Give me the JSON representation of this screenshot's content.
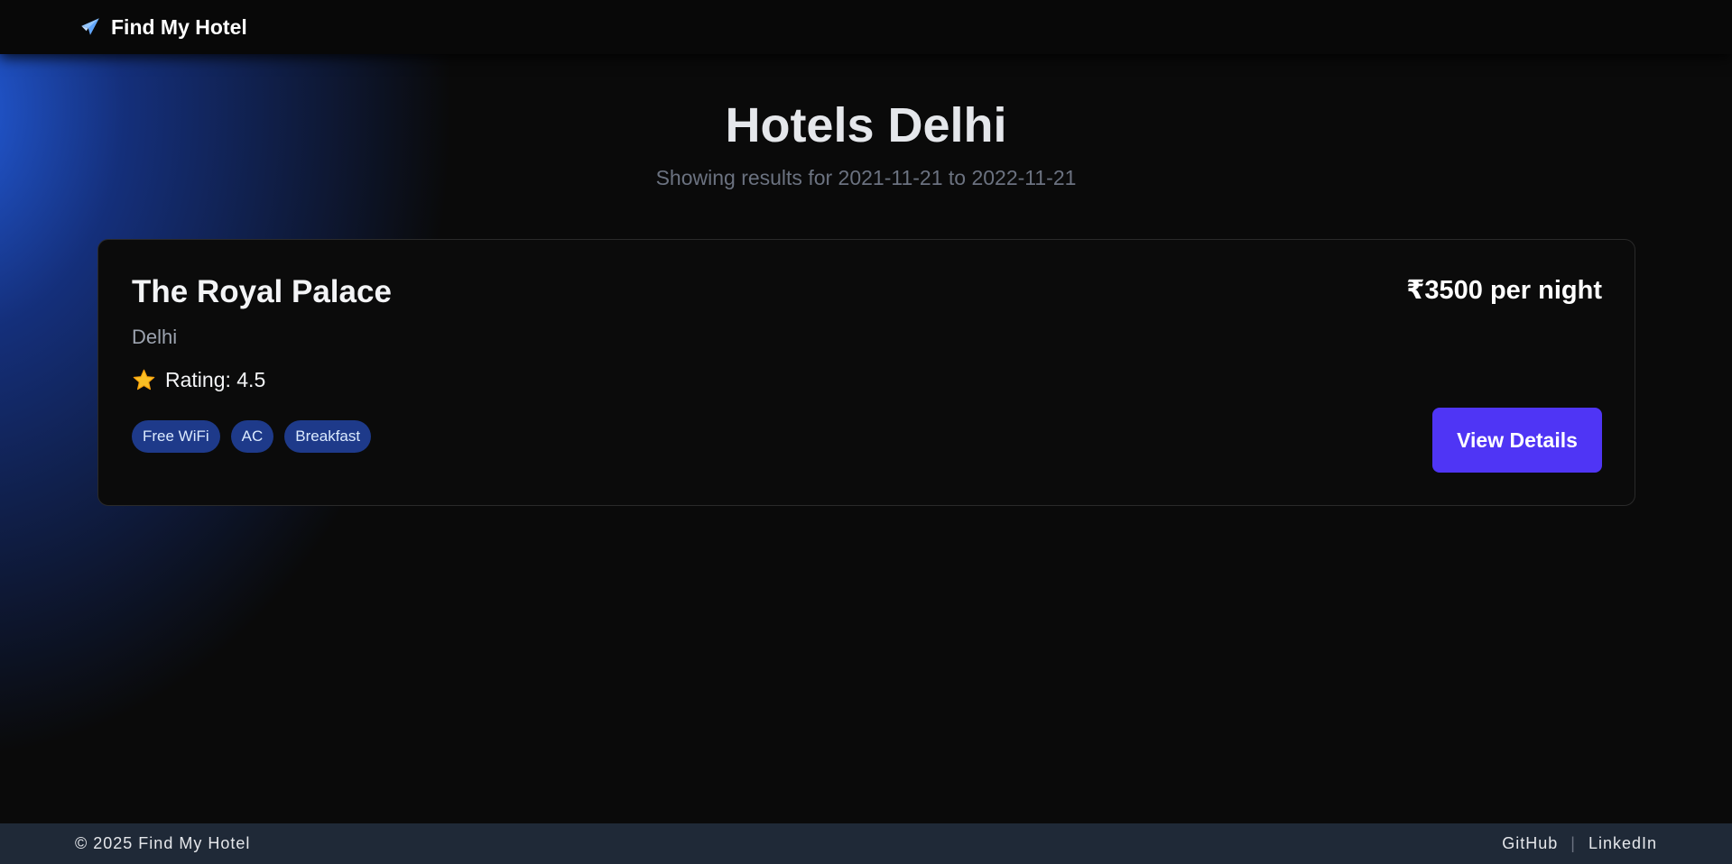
{
  "navbar": {
    "brand_icon": "airplane-icon",
    "brand_text": "Find My Hotel"
  },
  "header": {
    "title": "Hotels Delhi",
    "subtitle": "Showing results for 2021-11-21 to 2022-11-21"
  },
  "hotels": [
    {
      "name": "The Royal Palace",
      "city": "Delhi",
      "rating_icon": "star-icon",
      "rating_text": "Rating: 4.5",
      "amenities": [
        "Free WiFi",
        "AC",
        "Breakfast"
      ],
      "price": "₹3500 per night",
      "button_label": "View Details"
    }
  ],
  "footer": {
    "copyright": "© 2025 Find My Hotel",
    "links": [
      "GitHub",
      "LinkedIn"
    ],
    "separator": "|"
  },
  "colors": {
    "background": "#0a0a0a",
    "accent_glow": "#2563eb",
    "button": "#4f35f5",
    "tag_bg": "#1e3a8a",
    "footer_bg": "#1f2937"
  }
}
